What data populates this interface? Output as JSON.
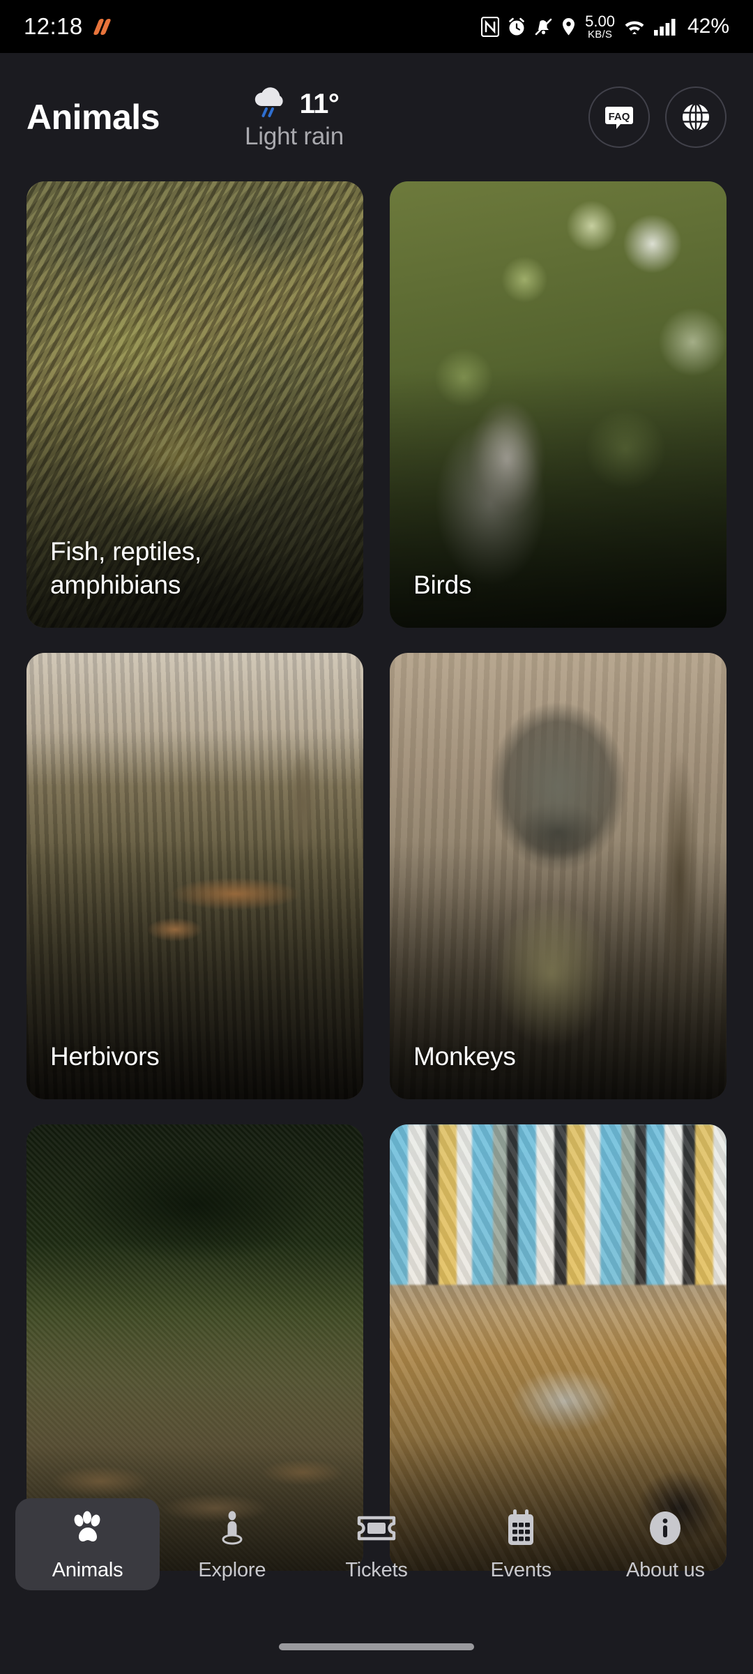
{
  "status_bar": {
    "time": "12:18",
    "app_icon": "stripes-icon",
    "icons": [
      "nfc-icon",
      "alarm-icon",
      "mute-icon",
      "location-icon"
    ],
    "network_speed_value": "5.00",
    "network_speed_unit": "KB/S",
    "wifi": "wifi-icon",
    "signal": "cellular-signal-icon",
    "battery": "42%"
  },
  "header": {
    "title": "Animals",
    "weather": {
      "icon": "rain-cloud-icon",
      "temperature": "11°",
      "description": "Light rain"
    },
    "faq_button": "FAQ",
    "language_button_icon": "globe-icon"
  },
  "grid": {
    "cards": [
      {
        "label": "Fish, reptiles,\namphibians",
        "image": "snake-photo",
        "photo_class": "ph-snake"
      },
      {
        "label": "Birds",
        "image": "ostrich-photo",
        "photo_class": "ph-birds"
      },
      {
        "label": "Herbivors",
        "image": "antelope-photo",
        "photo_class": "ph-herb"
      },
      {
        "label": "Monkeys",
        "image": "monkey-photo",
        "photo_class": "ph-monkey"
      },
      {
        "label": "",
        "image": "lions-photo",
        "photo_class": "ph-lions"
      },
      {
        "label": "",
        "image": "pig-photo",
        "photo_class": "ph-pig"
      }
    ]
  },
  "bottom_nav": {
    "items": [
      {
        "label": "Animals",
        "icon": "paw-icon",
        "active": true
      },
      {
        "label": "Explore",
        "icon": "explore-pin-icon",
        "active": false
      },
      {
        "label": "Tickets",
        "icon": "ticket-icon",
        "active": false
      },
      {
        "label": "Events",
        "icon": "calendar-icon",
        "active": false
      },
      {
        "label": "About us",
        "icon": "info-icon",
        "active": false
      }
    ]
  },
  "colors": {
    "background": "#1b1b20",
    "status_bar": "#000000",
    "accent_active": "#3a3a40",
    "text_primary": "#ffffff",
    "text_secondary": "#a9a9ae",
    "app_icon": "#e8743b",
    "rain_blue": "#2f6fd0"
  }
}
